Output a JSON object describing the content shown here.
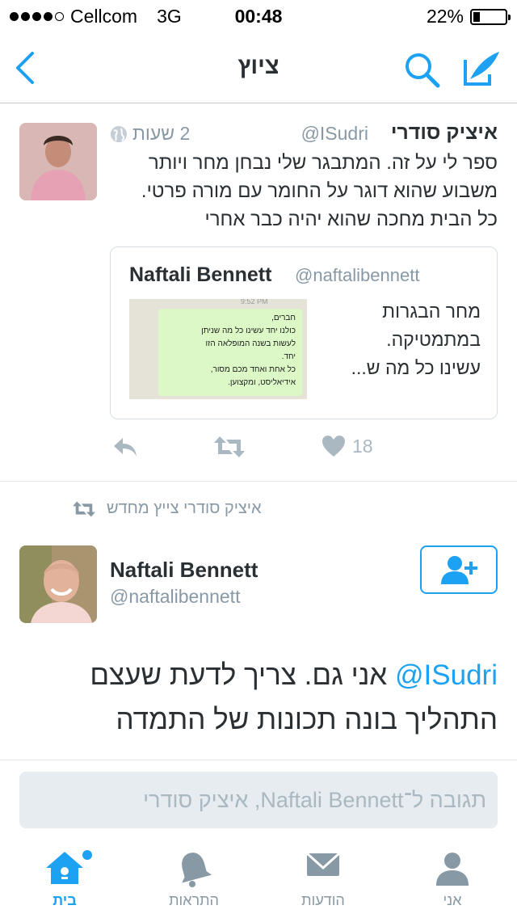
{
  "status_bar": {
    "carrier": "Cellcom",
    "network": "3G",
    "time": "00:48",
    "battery": "22%",
    "battery_level": 0.22
  },
  "nav": {
    "title": "ציוץ"
  },
  "tweet1": {
    "author_name": "איציק סודרי",
    "handle": "@ISudri",
    "time": "2 שעות",
    "text_lines": [
      "ספר לי על זה. המתבגר שלי נבחן מחר ויותר",
      "משבוע שהוא דוגר על החומר עם מורה פרטי.",
      "כל הבית מחכה שהוא יהיה כבר אחרי"
    ],
    "quote": {
      "name": "Naftali Bennett",
      "handle": "@naftalibennett",
      "text_lines": [
        "מחר הבגרות",
        "במתמטיקה.",
        "עשינו כל מה ש..."
      ],
      "image_timestamp": "9:52 PM",
      "image_lines": [
        "חברים,",
        "כולנו יחד עשינו כל מה שניתן",
        "לעשות בשנה המופלאה הזו",
        "יחד.",
        "כל אחת ואחד מכם מסור,",
        "אידיאליסט, ומקצוען."
      ]
    },
    "like_count": "18"
  },
  "tweet2": {
    "retweet_note": "איציק סודרי צייץ מחדש",
    "author_name": "Naftali Bennett",
    "handle": "@naftalibennett",
    "mention": "@ISudri",
    "text_rest_line1": "אני גם. צריך לדעת שעצם",
    "text_line2": "התהליך בונה תכונות של התמדה"
  },
  "reply": {
    "placeholder": "תגובה ל־Naftali Bennett, איציק סודרי"
  },
  "tabs": [
    {
      "label": "בית",
      "icon": "home-icon",
      "active": true
    },
    {
      "label": "התראות",
      "icon": "bell-icon",
      "active": false
    },
    {
      "label": "הודעות",
      "icon": "envelope-icon",
      "active": false
    },
    {
      "label": "אני",
      "icon": "person-icon",
      "active": false
    }
  ],
  "colors": {
    "accent": "#1da1f2",
    "muted": "#8899a6"
  }
}
